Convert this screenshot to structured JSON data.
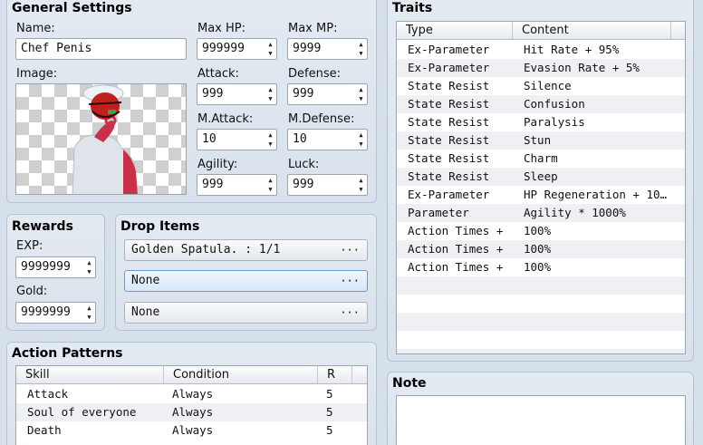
{
  "general": {
    "title": "General Settings",
    "name_label": "Name:",
    "name_value": "Chef Penis",
    "image_label": "Image:",
    "maxhp_label": "Max HP:",
    "maxhp_value": "999999",
    "maxmp_label": "Max MP:",
    "maxmp_value": "9999",
    "attack_label": "Attack:",
    "attack_value": "999",
    "defense_label": "Defense:",
    "defense_value": "999",
    "mattack_label": "M.Attack:",
    "mattack_value": "10",
    "mdefense_label": "M.Defense:",
    "mdefense_value": "10",
    "agility_label": "Agility:",
    "agility_value": "999",
    "luck_label": "Luck:",
    "luck_value": "999"
  },
  "rewards": {
    "title": "Rewards",
    "exp_label": "EXP:",
    "exp_value": "9999999",
    "gold_label": "Gold:",
    "gold_value": "9999999"
  },
  "drops": {
    "title": "Drop Items",
    "items": [
      "Golden Spatula. : 1/1",
      "None",
      "None"
    ],
    "more": "···"
  },
  "actions": {
    "title": "Action Patterns",
    "columns": [
      "Skill",
      "Condition",
      "R"
    ],
    "rows": [
      [
        "Attack",
        "Always",
        "5"
      ],
      [
        "Soul of everyone",
        "Always",
        "5"
      ],
      [
        "Death",
        "Always",
        "5"
      ]
    ]
  },
  "traits": {
    "title": "Traits",
    "columns": [
      "Type",
      "Content"
    ],
    "rows": [
      [
        "Ex-Parameter",
        "Hit Rate + 95%"
      ],
      [
        "Ex-Parameter",
        "Evasion Rate + 5%"
      ],
      [
        "State Resist",
        "Silence"
      ],
      [
        "State Resist",
        "Confusion"
      ],
      [
        "State Resist",
        "Paralysis"
      ],
      [
        "State Resist",
        "Stun"
      ],
      [
        "State Resist",
        "Charm"
      ],
      [
        "State Resist",
        "Sleep"
      ],
      [
        "Ex-Parameter",
        "HP Regeneration + 10…"
      ],
      [
        "Parameter",
        "Agility * 1000%"
      ],
      [
        "Action Times +",
        "100%"
      ],
      [
        "Action Times +",
        "100%"
      ],
      [
        "Action Times +",
        "100%"
      ]
    ]
  },
  "note": {
    "title": "Note"
  },
  "icons": {
    "spin_up": "▲",
    "spin_down": "▼"
  }
}
